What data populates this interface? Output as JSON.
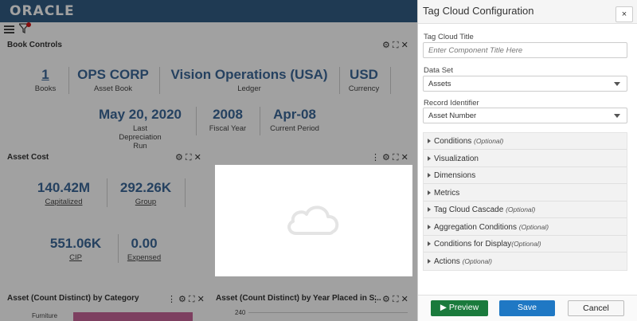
{
  "header": {
    "logo": "ORACLE"
  },
  "book_controls": {
    "title": "Book Controls",
    "kpis": [
      {
        "value": "1",
        "label": "Books"
      },
      {
        "value": "OPS CORP",
        "label": "Asset Book"
      },
      {
        "value": "Vision Operations (USA)",
        "label": "Ledger"
      },
      {
        "value": "USD",
        "label": "Currency"
      },
      {
        "value": "May 20, 2020",
        "label": "Last Depreciation Run"
      },
      {
        "value": "2008",
        "label": "Fiscal Year"
      },
      {
        "value": "Apr-08",
        "label": "Current Period"
      }
    ]
  },
  "asset_cost": {
    "title": "Asset Cost",
    "kpis": [
      {
        "value": "140.42M",
        "label": "Capitalized"
      },
      {
        "value": "292.26K",
        "label": "Group"
      },
      {
        "value": "551.06K",
        "label": "CIP"
      },
      {
        "value": "0.00",
        "label": "Expensed"
      }
    ]
  },
  "bottom_panels": {
    "left_title": "Asset (Count Distinct) by Category",
    "left_category": "Furniture",
    "right_title": "Asset (Count Distinct) by Year Placed in S...",
    "right_axis_value": "240"
  },
  "config": {
    "title": "Tag Cloud Configuration",
    "close_label": "×",
    "title_field_label": "Tag Cloud Title",
    "title_placeholder": "Enter Component Title Here",
    "dataset_label": "Data Set",
    "dataset_value": "Assets",
    "record_label": "Record Identifier",
    "record_value": "Asset Number",
    "sections": [
      {
        "label": "Conditions",
        "optional": "(Optional)"
      },
      {
        "label": "Visualization",
        "optional": ""
      },
      {
        "label": "Dimensions",
        "optional": ""
      },
      {
        "label": "Metrics",
        "optional": ""
      },
      {
        "label": "Tag Cloud Cascade",
        "optional": "(Optional)"
      },
      {
        "label": "Aggregation Conditions",
        "optional": "(Optional)"
      },
      {
        "label": "Conditions for Display",
        "optional": "(Optional)"
      },
      {
        "label": "Actions",
        "optional": "(Optional)"
      }
    ],
    "preview_label": "Preview",
    "save_label": "Save",
    "cancel_label": "Cancel"
  }
}
